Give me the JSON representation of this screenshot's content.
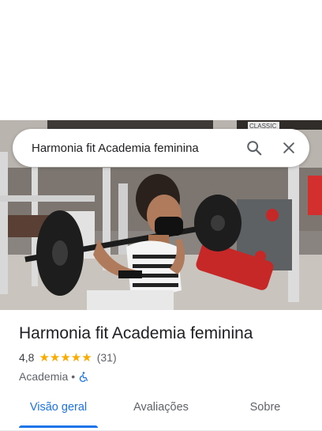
{
  "search": {
    "query": "Harmonia fit Academia feminina"
  },
  "hero": {
    "photo": "woman squatting with barbell in gym",
    "sign_text": "CLASSIC"
  },
  "place": {
    "title": "Harmonia fit Academia feminina",
    "rating": "4,8",
    "stars": "★★★★★",
    "review_count": "(31)",
    "category": "Academia",
    "separator": "•",
    "accessibility_icon": "wheelchair-icon"
  },
  "tabs": [
    {
      "label": "Visão geral",
      "active": true
    },
    {
      "label": "Avaliações",
      "active": false
    },
    {
      "label": "Sobre",
      "active": false
    }
  ],
  "colors": {
    "accent": "#1a73e8",
    "star": "#f9ab00",
    "text": "#202124",
    "muted": "#5f6368"
  }
}
